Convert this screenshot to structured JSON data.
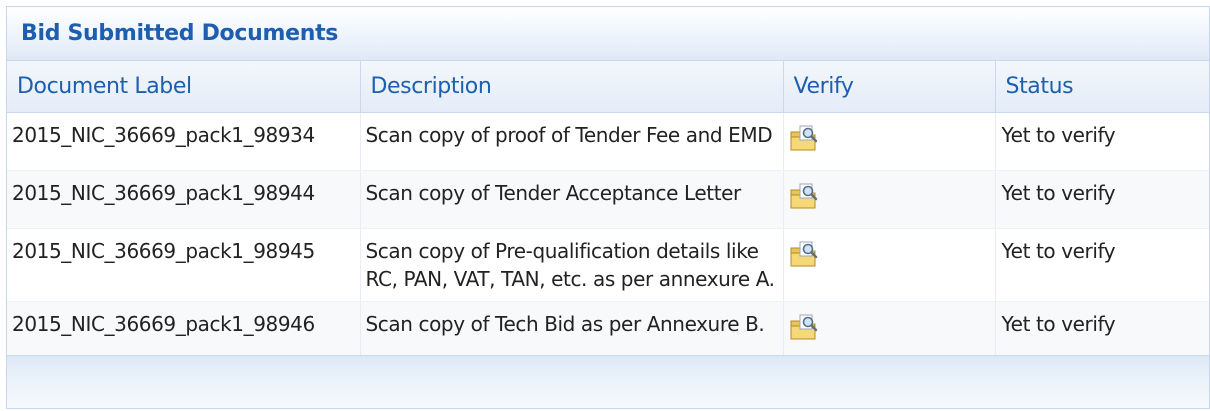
{
  "panel": {
    "title": "Bid Submitted Documents"
  },
  "table": {
    "headers": {
      "document_label": "Document Label",
      "description": "Description",
      "verify": "Verify",
      "status": "Status"
    },
    "rows": [
      {
        "document_label": "2015_NIC_36669_pack1_98934",
        "description": "Scan copy of proof of Tender Fee and EMD",
        "verify_icon": "folder-search-icon",
        "status": "Yet to verify"
      },
      {
        "document_label": "2015_NIC_36669_pack1_98944",
        "description": "Scan copy of Tender Acceptance Letter",
        "verify_icon": "folder-search-icon",
        "status": "Yet to verify"
      },
      {
        "document_label": "2015_NIC_36669_pack1_98945",
        "description": "Scan copy of Pre-qualification details like RC, PAN, VAT, TAN, etc. as per annexure A.",
        "verify_icon": "folder-search-icon",
        "status": "Yet to verify"
      },
      {
        "document_label": "2015_NIC_36669_pack1_98946",
        "description": "Scan copy of Tech Bid as per Annexure B.",
        "verify_icon": "folder-search-icon",
        "status": "Yet to verify"
      }
    ]
  },
  "colors": {
    "header_text": "#1d5fae",
    "body_text": "#222222",
    "border": "#c9d8ec"
  }
}
